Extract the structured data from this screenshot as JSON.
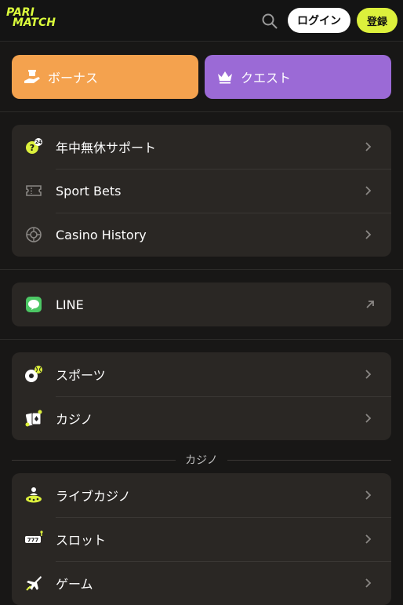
{
  "header": {
    "logo_line1": "PARI",
    "logo_line2": "MATCH",
    "login_label": "ログイン",
    "register_label": "登録",
    "search_icon": "search-icon"
  },
  "promos": {
    "bonus_label": "ボーナス",
    "bonus_color": "#f4a24e",
    "quest_label": "クエスト",
    "quest_color": "#9b6ad6"
  },
  "support_group": [
    {
      "label": "年中無休サポート",
      "icon": "support-24-icon"
    },
    {
      "label": "Sport Bets",
      "icon": "ticket-icon"
    },
    {
      "label": "Casino History",
      "icon": "roulette-icon"
    }
  ],
  "line_group": [
    {
      "label": "LINE",
      "icon": "line-icon"
    }
  ],
  "sports_group": [
    {
      "label": "スポーツ",
      "icon": "sports-ball-icon"
    },
    {
      "label": "カジノ",
      "icon": "cards-icon"
    }
  ],
  "casino_section": {
    "title": "カジノ",
    "items": [
      {
        "label": "ライブカジノ",
        "icon": "live-dealer-icon"
      },
      {
        "label": "スロット",
        "icon": "slot-777-icon"
      },
      {
        "label": "ゲーム",
        "icon": "plane-game-icon"
      }
    ]
  },
  "colors": {
    "accent": "#dcf03c",
    "background": "#181716",
    "card": "#2a2724"
  }
}
